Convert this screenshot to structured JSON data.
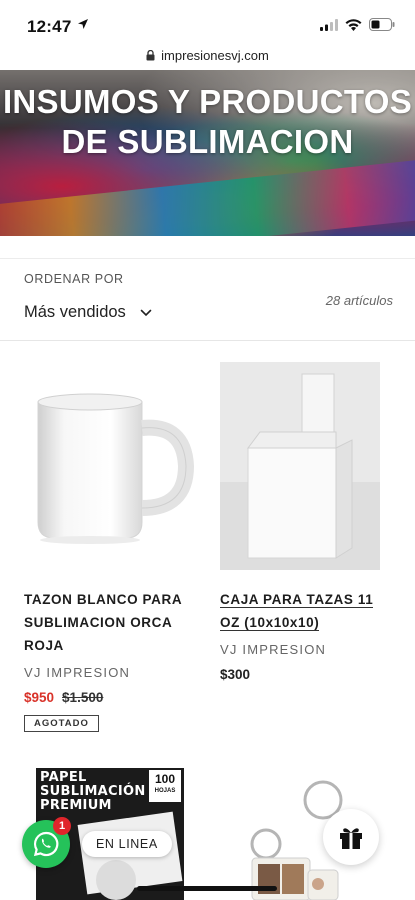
{
  "status_bar": {
    "time": "12:47"
  },
  "browser": {
    "url": "impresionesvj.com"
  },
  "hero": {
    "title": "INSUMOS Y PRODUCTOS DE SUBLIMACION"
  },
  "sort": {
    "label": "ORDENAR POR",
    "selected": "Más vendidos",
    "count": "28 artículos"
  },
  "products": [
    {
      "title": "TAZON BLANCO PARA SUBLIMACION ORCA ROJA",
      "vendor": "VJ IMPRESION",
      "sale_price": "$950",
      "compare_price": "$1.500",
      "badge": "AGOTADO"
    },
    {
      "title": "CAJA PARA TAZAS 11 OZ (10x10x10)",
      "vendor": "VJ IMPRESION",
      "price": "$300"
    }
  ],
  "thumbnails": {
    "left": {
      "line1": "PAPEL",
      "line2": "SUBLIMACIÓN",
      "line3": "PREMIUM",
      "badge_number": "100",
      "badge_text": "HOJAS"
    }
  },
  "chat": {
    "unread": "1",
    "status": "EN LINEA"
  },
  "colors": {
    "sale_red": "#d9332a",
    "whatsapp_green": "#25c25a",
    "badge_red": "#e0252b"
  }
}
